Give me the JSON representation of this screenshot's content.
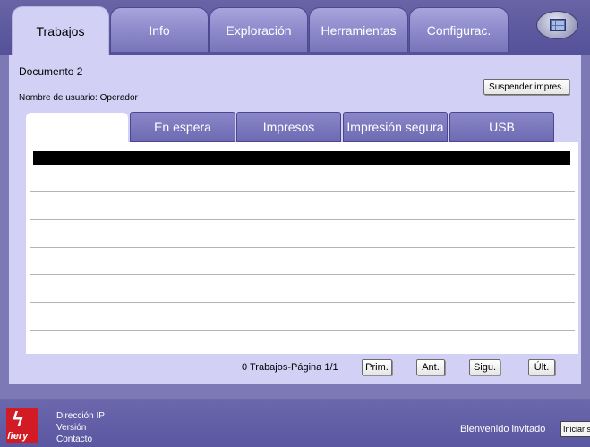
{
  "tabs": [
    {
      "label": "Trabajos",
      "active": true
    },
    {
      "label": "Info"
    },
    {
      "label": "Exploración"
    },
    {
      "label": "Herramientas"
    },
    {
      "label": "Configurac."
    }
  ],
  "document": {
    "title": "Documento 2",
    "user_line": "Nombre de usuario: Operador"
  },
  "suspend_button": "Suspender impres.",
  "sub_tabs": [
    "En espera",
    "Impresos",
    "Impresión segura",
    "USB"
  ],
  "pagination": {
    "info": "0 Trabajos-Página 1/1",
    "first": "Prim.",
    "prev": "Ant.",
    "next": "Sigu.",
    "last": "Últ."
  },
  "footer": {
    "logo_text": "fiery",
    "links": [
      "Dirección IP",
      "Versión",
      "Contacto"
    ],
    "welcome": "Bienvenido invitado",
    "login_button": "Iniciar sesión"
  },
  "colors": {
    "panel": "#d3d0f5",
    "background": "#7c79b4",
    "brand_red": "#d31b25"
  },
  "icons": {
    "top_right": "system-monitor-icon",
    "logo": "fiery-logo"
  }
}
